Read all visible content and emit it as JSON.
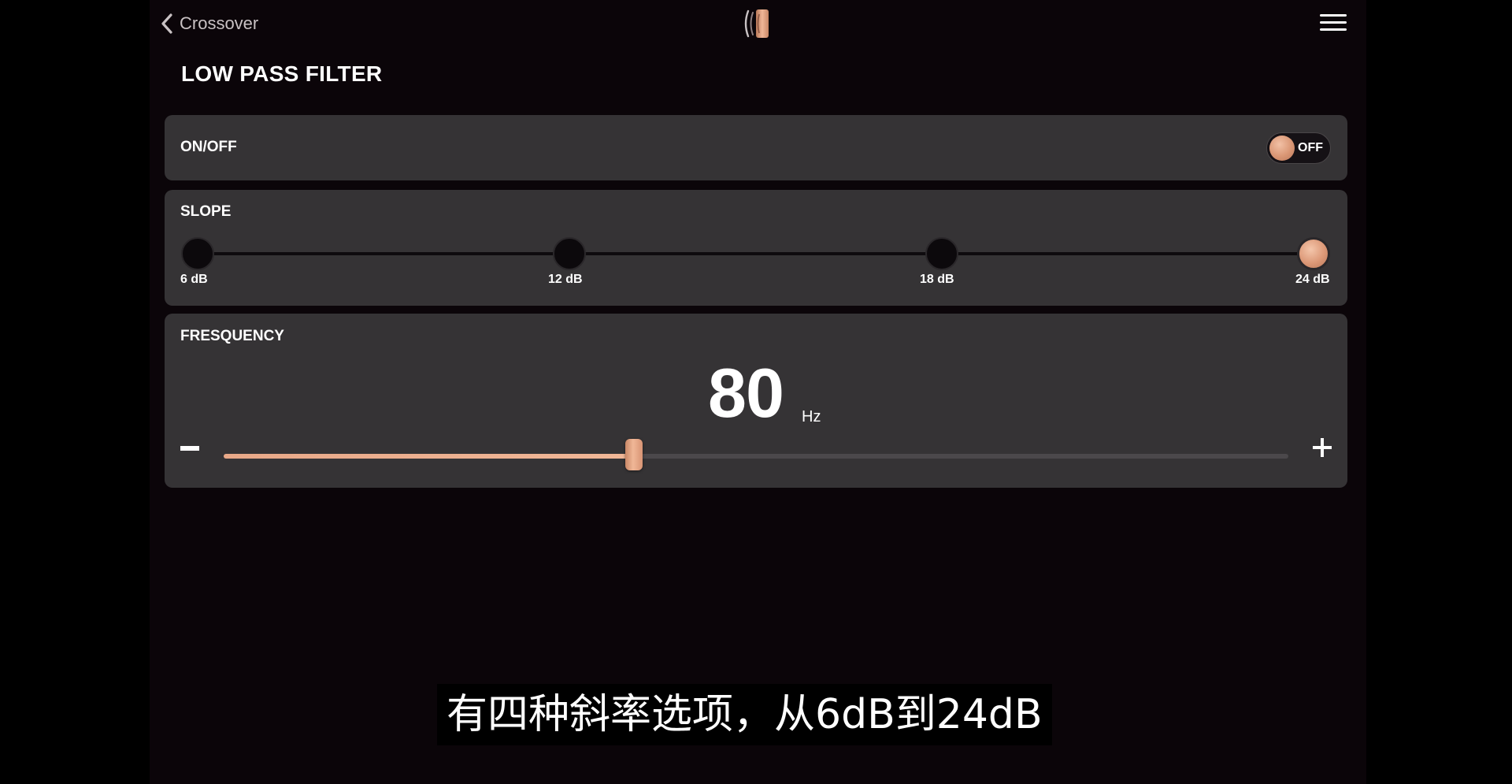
{
  "header": {
    "back_label": "Crossover",
    "logo_icon": "speaker-logo-icon",
    "menu_icon": "hamburger-menu-icon"
  },
  "page": {
    "title": "LOW PASS FILTER"
  },
  "onoff": {
    "label": "ON/OFF",
    "toggle_state": "OFF",
    "enabled": false
  },
  "slope": {
    "label": "SLOPE",
    "options": [
      "6 dB",
      "12 dB",
      "18 dB",
      "24 dB"
    ],
    "selected_index": 3
  },
  "frequency": {
    "label": "FRESQUENCY",
    "value": "80",
    "unit": "Hz",
    "slider_fraction": 0.385,
    "minus_icon": "minus-icon",
    "plus_icon": "plus-icon"
  },
  "subtitle": {
    "text": "有四种斜率选项，从6dB到24dB"
  },
  "colors": {
    "accent": "#e4a283",
    "card": "#353335",
    "background": "#0b0509"
  }
}
